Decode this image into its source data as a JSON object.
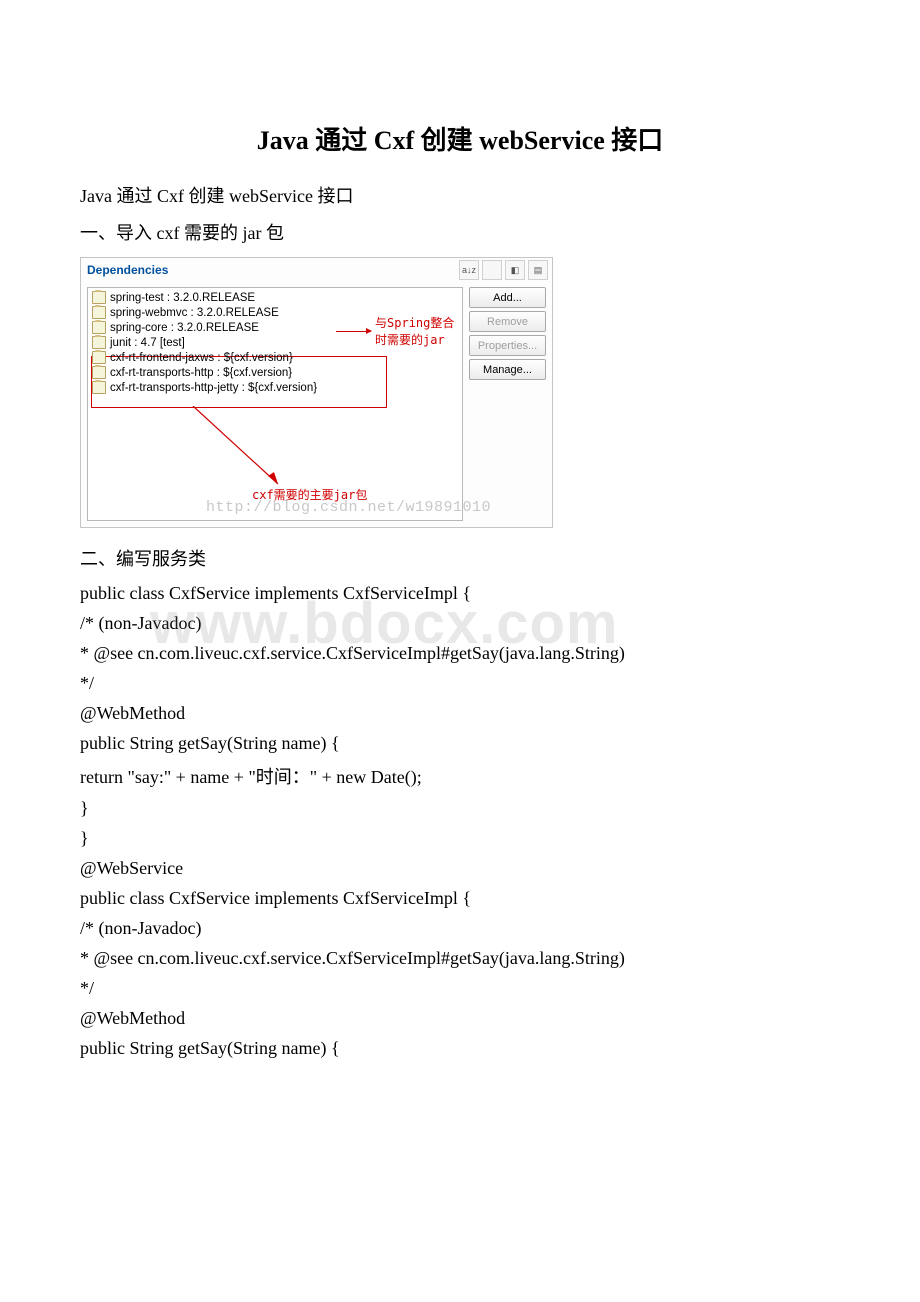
{
  "title": "Java 通过 Cxf 创建 webService 接口",
  "intro_repeat": "Java 通过 Cxf 创建 webService 接口",
  "section1": "一、导入 cxf 需要的 jar 包",
  "dependencies": {
    "header": "Dependencies",
    "items": [
      "spring-test : 3.2.0.RELEASE",
      "spring-webmvc : 3.2.0.RELEASE",
      "spring-core : 3.2.0.RELEASE",
      "junit : 4.7 [test]",
      "cxf-rt-frontend-jaxws : ${cxf.version}",
      "cxf-rt-transports-http : ${cxf.version}",
      "cxf-rt-transports-http-jetty : ${cxf.version}"
    ],
    "buttons": {
      "add": "Add...",
      "remove": "Remove",
      "properties": "Properties...",
      "manage": "Manage..."
    },
    "annot_spring": "与Spring整合时需要的jar",
    "annot_cxf": "cxf需要的主要jar包",
    "watermark_url": "http://blog.csdn.net/w19891010"
  },
  "section2": "二、编写服务类",
  "code_lines": [
    "public class CxfService implements CxfServiceImpl {",
    "/* (non-Javadoc)",
    " * @see cn.com.liveuc.cxf.service.CxfServiceImpl#getSay(java.lang.String)",
    " */",
    " @WebMethod",
    " public String getSay(String name) {",
    " return \"say:\" + name + \"时间：\" + new Date();",
    " }",
    "}",
    "@WebService",
    "public class CxfService implements CxfServiceImpl {",
    "/* (non-Javadoc)",
    " * @see cn.com.liveuc.cxf.service.CxfServiceImpl#getSay(java.lang.String)",
    " */",
    " @WebMethod",
    " public String getSay(String name) {"
  ],
  "watermark_big": "www.bdocx.com"
}
